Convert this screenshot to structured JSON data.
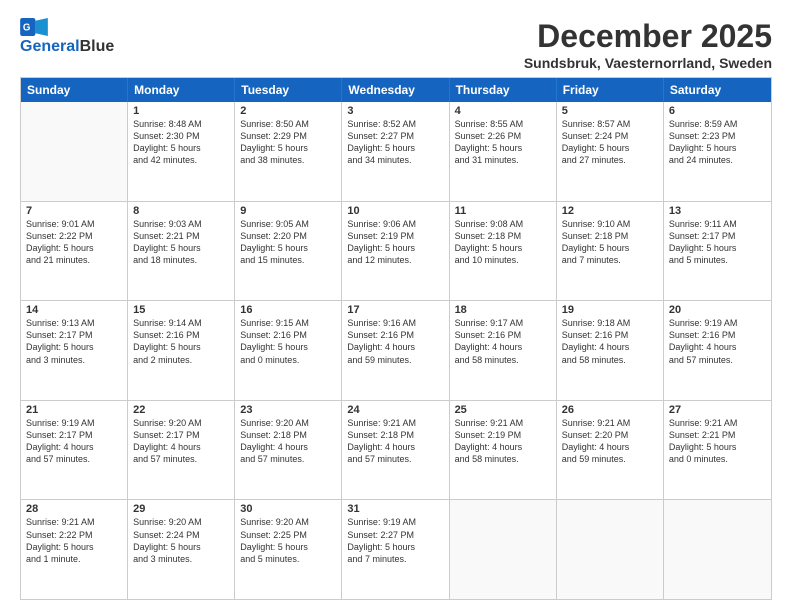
{
  "logo": {
    "line1": "General",
    "line2": "Blue"
  },
  "title": "December 2025",
  "subtitle": "Sundsbruk, Vaesternorrland, Sweden",
  "header_days": [
    "Sunday",
    "Monday",
    "Tuesday",
    "Wednesday",
    "Thursday",
    "Friday",
    "Saturday"
  ],
  "weeks": [
    [
      {
        "day": "",
        "info": ""
      },
      {
        "day": "1",
        "info": "Sunrise: 8:48 AM\nSunset: 2:30 PM\nDaylight: 5 hours\nand 42 minutes."
      },
      {
        "day": "2",
        "info": "Sunrise: 8:50 AM\nSunset: 2:29 PM\nDaylight: 5 hours\nand 38 minutes."
      },
      {
        "day": "3",
        "info": "Sunrise: 8:52 AM\nSunset: 2:27 PM\nDaylight: 5 hours\nand 34 minutes."
      },
      {
        "day": "4",
        "info": "Sunrise: 8:55 AM\nSunset: 2:26 PM\nDaylight: 5 hours\nand 31 minutes."
      },
      {
        "day": "5",
        "info": "Sunrise: 8:57 AM\nSunset: 2:24 PM\nDaylight: 5 hours\nand 27 minutes."
      },
      {
        "day": "6",
        "info": "Sunrise: 8:59 AM\nSunset: 2:23 PM\nDaylight: 5 hours\nand 24 minutes."
      }
    ],
    [
      {
        "day": "7",
        "info": "Sunrise: 9:01 AM\nSunset: 2:22 PM\nDaylight: 5 hours\nand 21 minutes."
      },
      {
        "day": "8",
        "info": "Sunrise: 9:03 AM\nSunset: 2:21 PM\nDaylight: 5 hours\nand 18 minutes."
      },
      {
        "day": "9",
        "info": "Sunrise: 9:05 AM\nSunset: 2:20 PM\nDaylight: 5 hours\nand 15 minutes."
      },
      {
        "day": "10",
        "info": "Sunrise: 9:06 AM\nSunset: 2:19 PM\nDaylight: 5 hours\nand 12 minutes."
      },
      {
        "day": "11",
        "info": "Sunrise: 9:08 AM\nSunset: 2:18 PM\nDaylight: 5 hours\nand 10 minutes."
      },
      {
        "day": "12",
        "info": "Sunrise: 9:10 AM\nSunset: 2:18 PM\nDaylight: 5 hours\nand 7 minutes."
      },
      {
        "day": "13",
        "info": "Sunrise: 9:11 AM\nSunset: 2:17 PM\nDaylight: 5 hours\nand 5 minutes."
      }
    ],
    [
      {
        "day": "14",
        "info": "Sunrise: 9:13 AM\nSunset: 2:17 PM\nDaylight: 5 hours\nand 3 minutes."
      },
      {
        "day": "15",
        "info": "Sunrise: 9:14 AM\nSunset: 2:16 PM\nDaylight: 5 hours\nand 2 minutes."
      },
      {
        "day": "16",
        "info": "Sunrise: 9:15 AM\nSunset: 2:16 PM\nDaylight: 5 hours\nand 0 minutes."
      },
      {
        "day": "17",
        "info": "Sunrise: 9:16 AM\nSunset: 2:16 PM\nDaylight: 4 hours\nand 59 minutes."
      },
      {
        "day": "18",
        "info": "Sunrise: 9:17 AM\nSunset: 2:16 PM\nDaylight: 4 hours\nand 58 minutes."
      },
      {
        "day": "19",
        "info": "Sunrise: 9:18 AM\nSunset: 2:16 PM\nDaylight: 4 hours\nand 58 minutes."
      },
      {
        "day": "20",
        "info": "Sunrise: 9:19 AM\nSunset: 2:16 PM\nDaylight: 4 hours\nand 57 minutes."
      }
    ],
    [
      {
        "day": "21",
        "info": "Sunrise: 9:19 AM\nSunset: 2:17 PM\nDaylight: 4 hours\nand 57 minutes."
      },
      {
        "day": "22",
        "info": "Sunrise: 9:20 AM\nSunset: 2:17 PM\nDaylight: 4 hours\nand 57 minutes."
      },
      {
        "day": "23",
        "info": "Sunrise: 9:20 AM\nSunset: 2:18 PM\nDaylight: 4 hours\nand 57 minutes."
      },
      {
        "day": "24",
        "info": "Sunrise: 9:21 AM\nSunset: 2:18 PM\nDaylight: 4 hours\nand 57 minutes."
      },
      {
        "day": "25",
        "info": "Sunrise: 9:21 AM\nSunset: 2:19 PM\nDaylight: 4 hours\nand 58 minutes."
      },
      {
        "day": "26",
        "info": "Sunrise: 9:21 AM\nSunset: 2:20 PM\nDaylight: 4 hours\nand 59 minutes."
      },
      {
        "day": "27",
        "info": "Sunrise: 9:21 AM\nSunset: 2:21 PM\nDaylight: 5 hours\nand 0 minutes."
      }
    ],
    [
      {
        "day": "28",
        "info": "Sunrise: 9:21 AM\nSunset: 2:22 PM\nDaylight: 5 hours\nand 1 minute."
      },
      {
        "day": "29",
        "info": "Sunrise: 9:20 AM\nSunset: 2:24 PM\nDaylight: 5 hours\nand 3 minutes."
      },
      {
        "day": "30",
        "info": "Sunrise: 9:20 AM\nSunset: 2:25 PM\nDaylight: 5 hours\nand 5 minutes."
      },
      {
        "day": "31",
        "info": "Sunrise: 9:19 AM\nSunset: 2:27 PM\nDaylight: 5 hours\nand 7 minutes."
      },
      {
        "day": "",
        "info": ""
      },
      {
        "day": "",
        "info": ""
      },
      {
        "day": "",
        "info": ""
      }
    ]
  ]
}
